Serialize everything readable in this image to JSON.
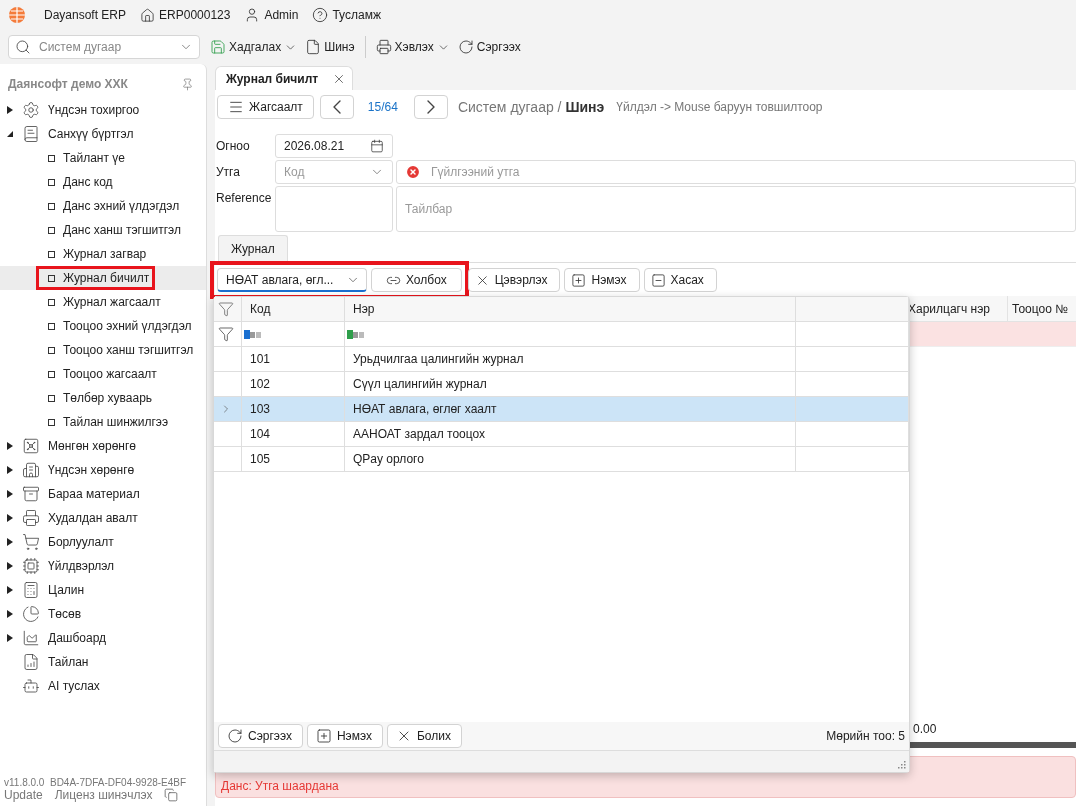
{
  "app_bar": {
    "product": "Dayansoft ERP",
    "company_code": "ERP0000123",
    "user": "Admin",
    "help": "Тусламж"
  },
  "toolbar": {
    "search_placeholder": "Систем дугаар",
    "save": "Хадгалах",
    "new": "Шинэ",
    "print": "Хэвлэх",
    "refresh": "Сэргээх"
  },
  "sidebar": {
    "title": "Даянсофт демо ХХК",
    "items": [
      {
        "label": "Үндсэн тохиргоо",
        "kind": "folder",
        "expanded": false
      },
      {
        "label": "Санхүү бүртгэл",
        "kind": "folder",
        "expanded": true,
        "children": [
          {
            "label": "Тайлант үе",
            "selected": false,
            "highlighted": false
          },
          {
            "label": "Данс код",
            "selected": false,
            "highlighted": false
          },
          {
            "label": "Данс эхний үлдэгдэл",
            "selected": false,
            "highlighted": false
          },
          {
            "label": "Данс ханш тэгшитгэл",
            "selected": false,
            "highlighted": false
          },
          {
            "label": "Журнал загвар",
            "selected": false,
            "highlighted": false
          },
          {
            "label": "Журнал бичилт",
            "selected": true,
            "highlighted": true
          },
          {
            "label": "Журнал жагсаалт",
            "selected": false,
            "highlighted": false
          },
          {
            "label": "Тооцоо эхний үлдэгдэл",
            "selected": false,
            "highlighted": false
          },
          {
            "label": "Тооцоо ханш тэгшитгэл",
            "selected": false,
            "highlighted": false
          },
          {
            "label": "Тооцоо жагсаалт",
            "selected": false,
            "highlighted": false
          },
          {
            "label": "Төлбөр хуваарь",
            "selected": false,
            "highlighted": false
          },
          {
            "label": "Тайлан шинжилгээ",
            "selected": false,
            "highlighted": false
          }
        ]
      },
      {
        "label": "Мөнгөн хөрөнгө",
        "kind": "folder",
        "expanded": false
      },
      {
        "label": "Үндсэн хөрөнгө",
        "kind": "folder",
        "expanded": false
      },
      {
        "label": "Бараа материал",
        "kind": "folder",
        "expanded": false
      },
      {
        "label": "Худалдан авалт",
        "kind": "folder",
        "expanded": false
      },
      {
        "label": "Борлуулалт",
        "kind": "folder",
        "expanded": false
      },
      {
        "label": "Үйлдвэрлэл",
        "kind": "folder",
        "expanded": false
      },
      {
        "label": "Цалин",
        "kind": "folder",
        "expanded": false
      },
      {
        "label": "Төсөв",
        "kind": "folder",
        "expanded": false
      },
      {
        "label": "Дашбоард",
        "kind": "folder",
        "expanded": false
      },
      {
        "label": "Тайлан",
        "kind": "link"
      },
      {
        "label": "AI туслах",
        "kind": "link"
      }
    ],
    "version": "v11.8.0.0",
    "license_key": "BD4A-7DFA-DF04-9928-E4BF",
    "update": "Update",
    "renew_license": "Лиценз шинэчлэх"
  },
  "tabs": [
    {
      "label": "Журнал бичилт",
      "selected": true
    }
  ],
  "nav": {
    "list_button": "Жагсаалт",
    "position": "15/64",
    "breadcrumb": "Систем дугаар / **Шинэ**",
    "hint": "Үйлдэл -> Mouse баруун товшилтоор"
  },
  "form": {
    "date_label": "Огноо",
    "date": "2026.08.21",
    "value_label": "Утга",
    "code_placeholder": "Код",
    "value_placeholder": "Гүйлгээний утга",
    "value_error": true,
    "reference_label": "Reference",
    "note_placeholder": "Тайлбар"
  },
  "detail_tabs": [
    {
      "label": "Журнал",
      "selected": true
    }
  ],
  "journal_toolbar": {
    "template": "НӨАТ авлага, өгл...",
    "link": "Холбох",
    "highlighted": true,
    "buttons": [
      {
        "label": "Цэвэрлэх",
        "kind": "clear"
      },
      {
        "label": "Нэмэх",
        "kind": "add"
      },
      {
        "label": "Хасах",
        "kind": "remove"
      }
    ]
  },
  "grid": {
    "columns": [
      "Харилцагч нэр",
      "Тооцоо №"
    ],
    "total": "0.00"
  },
  "errors": [
    "Данс: Утга шаардана"
  ],
  "popup": {
    "columns": [
      "Код",
      "Нэр"
    ],
    "rows": [
      {
        "code": "101",
        "name": "Урьдчилгаа цалингийн журнал",
        "selected": false
      },
      {
        "code": "102",
        "name": "Сүүл цалингийн журнал",
        "selected": false
      },
      {
        "code": "103",
        "name": "НӨАТ авлага, өглөг хаалт",
        "selected": true
      },
      {
        "code": "104",
        "name": "ААНОАТ зардал тооцох",
        "selected": false
      },
      {
        "code": "105",
        "name": "QPay орлого",
        "selected": false
      }
    ],
    "buttons": [
      {
        "label": "Сэргээх",
        "kind": "refresh"
      },
      {
        "label": "Нэмэх",
        "kind": "add"
      },
      {
        "label": "Болих",
        "kind": "cancel"
      }
    ],
    "row_count": "Мөрийн тоо: 5"
  }
}
